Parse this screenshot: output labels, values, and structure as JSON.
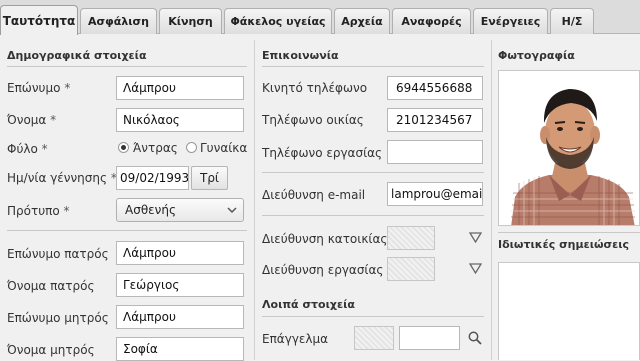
{
  "tabs": [
    {
      "label": "Ταυτότητα",
      "active": true
    },
    {
      "label": "Ασφάλιση"
    },
    {
      "label": "Κίνηση"
    },
    {
      "label": "Φάκελος υγείας"
    },
    {
      "label": "Αρχεία"
    },
    {
      "label": "Αναφορές"
    },
    {
      "label": "Ενέργειες"
    },
    {
      "label": "Η/Σ"
    }
  ],
  "demographics": {
    "title": "Δημογραφικά στοιχεία",
    "surname": {
      "label": "Επώνυμο",
      "value": "Λάμπρου"
    },
    "firstname": {
      "label": "Όνομα",
      "value": "Νικόλαος"
    },
    "gender": {
      "label": "Φύλο",
      "options": [
        "Άντρας",
        "Γυναίκα"
      ],
      "selected": "Άντρας"
    },
    "birthdate": {
      "label": "Ημ/νία γέννησης",
      "value": "09/02/1993",
      "day_button": "Τρί"
    },
    "template": {
      "label": "Πρότυπο",
      "value": "Ασθενής"
    },
    "father_surname": {
      "label": "Επώνυμο πατρός",
      "value": "Λάμπρου"
    },
    "father_name": {
      "label": "Όνομα πατρός",
      "value": "Γεώργιος"
    },
    "mother_surname": {
      "label": "Επώνυμο μητρός",
      "value": "Λάμπρου"
    },
    "mother_name": {
      "label": "Όνομα μητρός",
      "value": "Σοφία"
    },
    "required_mark": "*"
  },
  "contact": {
    "title": "Επικοινωνία",
    "mobile": {
      "label": "Κινητό τηλέφωνο",
      "value": "6944556688"
    },
    "home_phone": {
      "label": "Τηλέφωνο οικίας",
      "value": "2101234567"
    },
    "work_phone": {
      "label": "Τηλέφωνο εργασίας",
      "value": ""
    },
    "email": {
      "label": "Διεύθυνση e-mail",
      "value": "lamprou@email."
    },
    "home_address": {
      "label": "Διεύθυνση κατοικίας"
    },
    "work_address": {
      "label": "Διεύθυνση εργασίας"
    }
  },
  "other": {
    "title": "Λοιπά στοιχεία",
    "profession": {
      "label": "Επάγγελμα",
      "value": ""
    }
  },
  "photo": {
    "title": "Φωτογραφία"
  },
  "notes": {
    "title": "Ιδιωτικές σημειώσεις"
  },
  "icons": {
    "expand": "triangle-down-icon",
    "search": "search-icon",
    "select_arrow": "chevron-down-icon"
  }
}
